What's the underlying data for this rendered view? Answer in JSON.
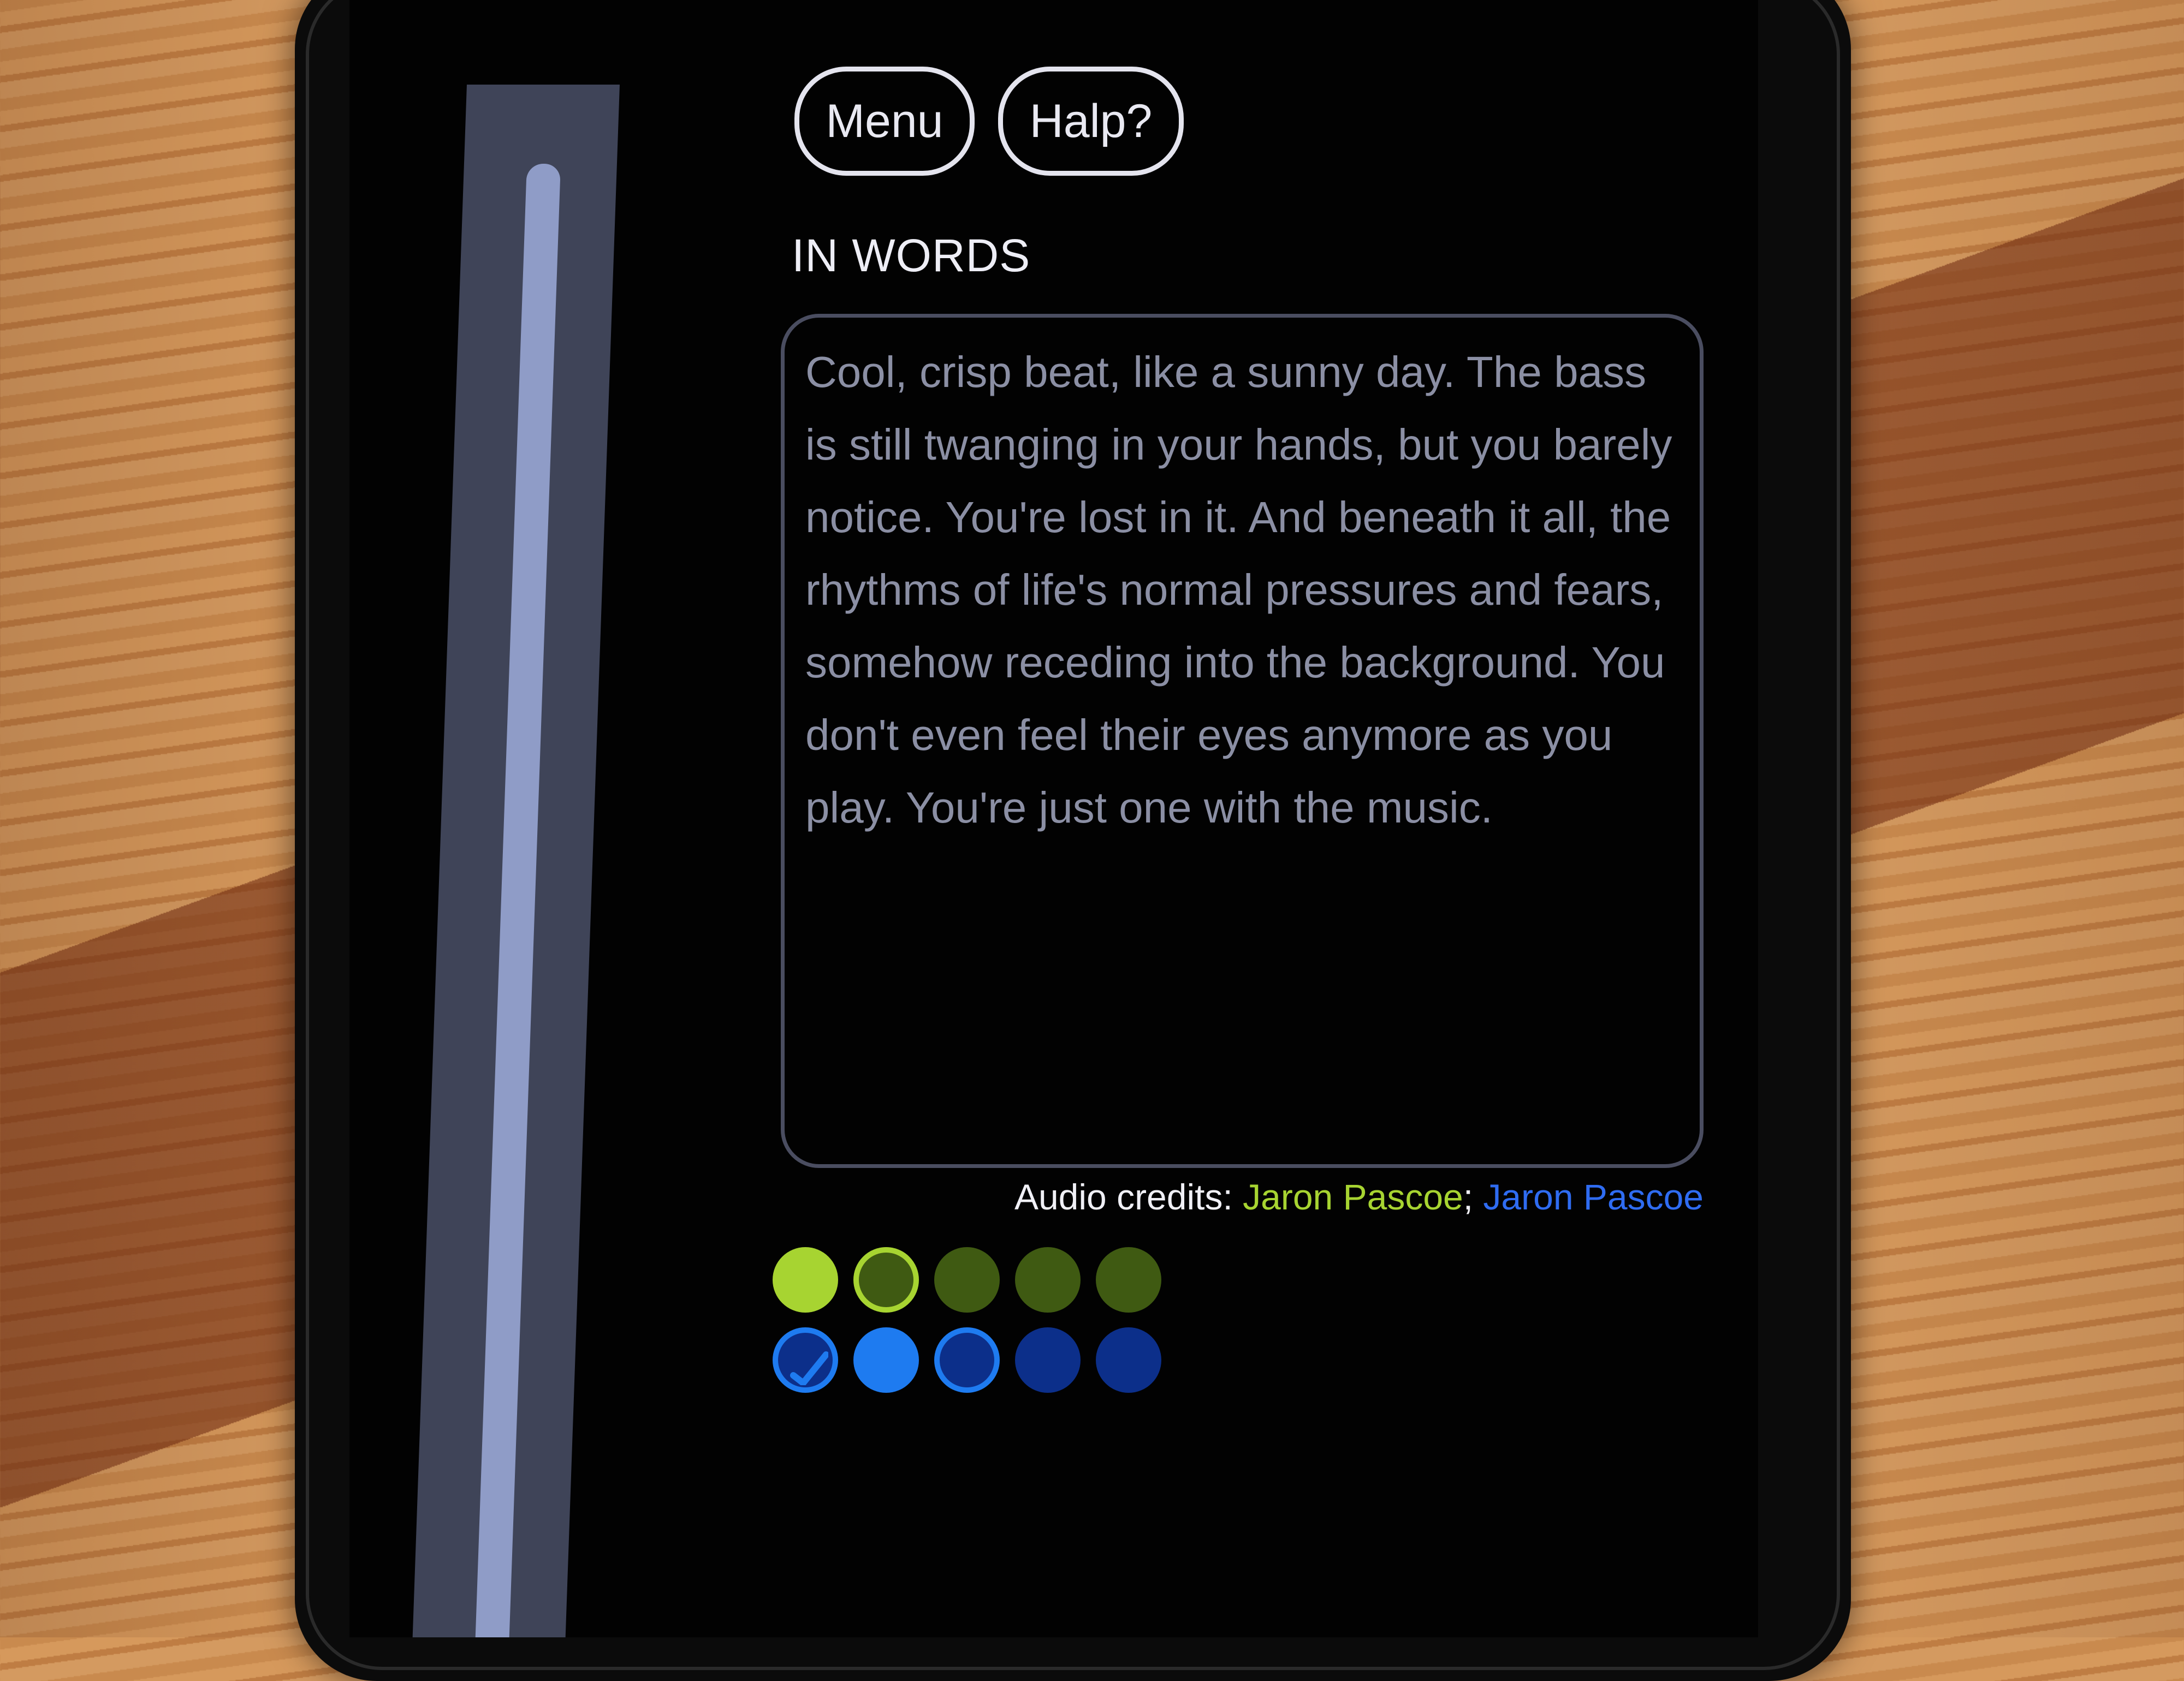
{
  "menu_button": {
    "label": "Menu"
  },
  "help_button": {
    "label": "Halp?"
  },
  "section_title": "IN WORDS",
  "description": "Cool, crisp beat, like a sunny day. The bass is still twanging in your hands, but you barely notice. You're lost in it. And beneath it all, the rhythms of life's normal pressures and fears, somehow receding into the background. You don't even feel their eyes anymore as you play. You're just one with the music.",
  "credits": {
    "label": "Audio credits:",
    "green_artist": "Jaron Pascoe",
    "separator": ";",
    "blue_artist": "Jaron Pascoe"
  },
  "colors": {
    "green_active": "#a7d431",
    "green_dim": "#3f5a12",
    "blue_active": "#1e7bf0",
    "blue_dim": "#0c2f8a",
    "slider_fill": "#8f9cc7",
    "slider_track": "#3f4458"
  },
  "green_levels": {
    "filled": 1,
    "selected": 2,
    "total": 5
  },
  "blue_levels": {
    "checked": 1,
    "filled": 2,
    "selected": 3,
    "total": 5
  },
  "side_slider": {
    "level": 0.97
  }
}
